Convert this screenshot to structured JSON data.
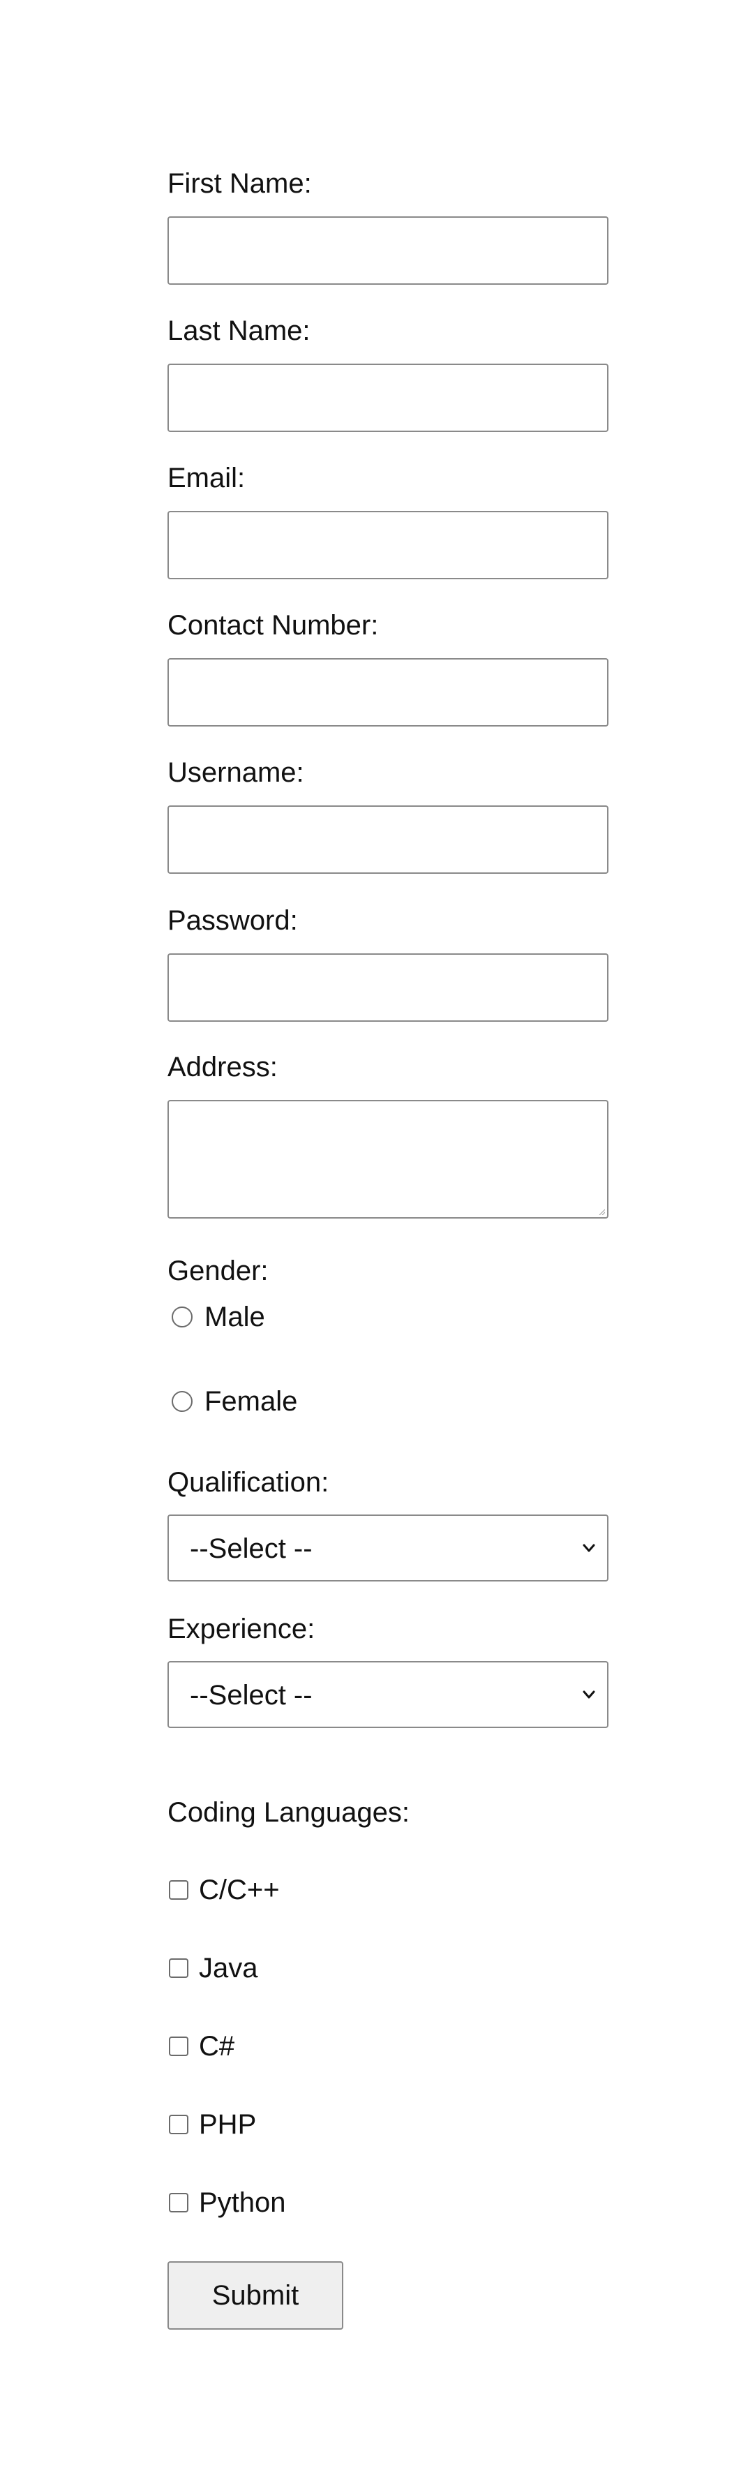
{
  "form": {
    "first_name": {
      "label": "First Name:",
      "value": ""
    },
    "last_name": {
      "label": "Last Name:",
      "value": ""
    },
    "email": {
      "label": "Email:",
      "value": ""
    },
    "contact_number": {
      "label": "Contact Number:",
      "value": ""
    },
    "username": {
      "label": "Username:",
      "value": ""
    },
    "password": {
      "label": "Password:",
      "value": ""
    },
    "address": {
      "label": "Address:",
      "value": ""
    },
    "gender": {
      "label": "Gender:",
      "options": [
        "Male",
        "Female"
      ],
      "selected": null
    },
    "qualification": {
      "label": "Qualification:",
      "selected": "--Select --"
    },
    "experience": {
      "label": "Experience:",
      "selected": "--Select --"
    },
    "coding_languages": {
      "label": "Coding Languages:",
      "options": [
        "C/C++",
        "Java",
        "C#",
        "PHP",
        "Python"
      ],
      "checked": []
    },
    "submit_label": "Submit"
  }
}
